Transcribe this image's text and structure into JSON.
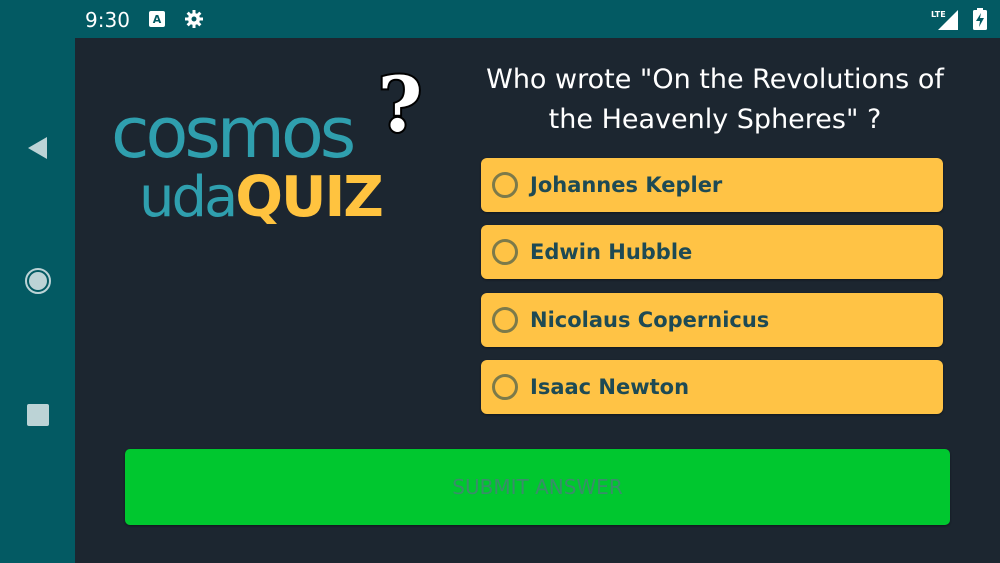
{
  "status_bar": {
    "time": "9:30",
    "network_label": "LTE",
    "icons": [
      "text-a-icon",
      "gear-icon",
      "lte-signal-icon",
      "battery-charging-icon"
    ]
  },
  "nav_bar": {
    "icons": [
      "back-triangle-icon",
      "home-circle-icon",
      "recents-square-icon"
    ]
  },
  "logo": {
    "line1": "cosmos",
    "line2_a": "uda",
    "line2_b": "QUIZ",
    "mark": "?"
  },
  "quiz": {
    "question": "Who wrote \"On the Revolutions of the Heavenly Spheres\" ?",
    "options": [
      {
        "label": "Johannes Kepler",
        "selected": false
      },
      {
        "label": "Edwin Hubble",
        "selected": false
      },
      {
        "label": "Nicolaus Copernicus",
        "selected": false
      },
      {
        "label": "Isaac Newton",
        "selected": false
      }
    ],
    "submit_label": "SUBMIT ANSWER"
  },
  "colors": {
    "frame": "#035a63",
    "background": "#1c2630",
    "option": "#ffc345",
    "submit": "#00c72f",
    "logo_teal": "#2f9fae",
    "logo_yellow": "#ffc33f"
  }
}
